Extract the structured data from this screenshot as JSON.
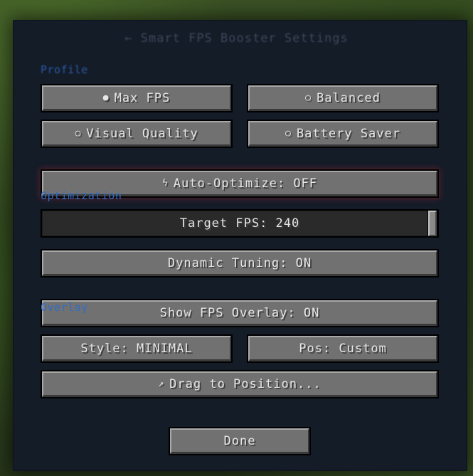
{
  "screen": {
    "title": "← Smart FPS Booster Settings"
  },
  "sections": {
    "profile": "Profile",
    "optimization": "Optimization",
    "overlay": "Overlay"
  },
  "profile_buttons": [
    {
      "icon": "●",
      "label": "Max FPS"
    },
    {
      "icon": "○",
      "label": "Balanced"
    },
    {
      "icon": "○",
      "label": "Visual Quality"
    },
    {
      "icon": "○",
      "label": "Battery Saver"
    }
  ],
  "optimization": {
    "auto_icon": "ϟ",
    "auto_label": "Auto-Optimize: OFF",
    "target_fps_label": "Target FPS: 240",
    "target_fps_value": 240,
    "target_fps_fraction": 1.0,
    "dynamic_label": "Dynamic Tuning: ON"
  },
  "overlay": {
    "show_label": "Show FPS Overlay: ON",
    "style_label": "Style: MINIMAL",
    "pos_label": "Pos: Custom",
    "drag_icon": "↗",
    "drag_label": "Drag to Position..."
  },
  "footer": {
    "done_label": "Done"
  }
}
